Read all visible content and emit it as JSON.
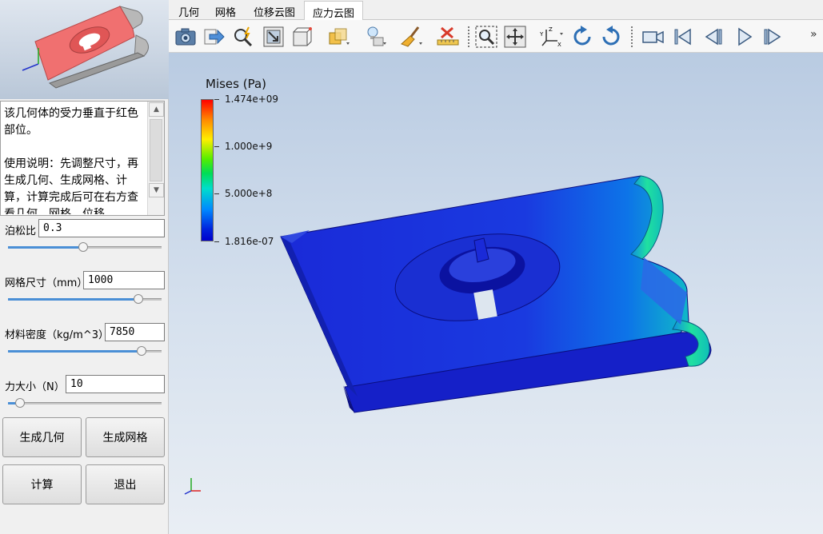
{
  "tabs": [
    "几何",
    "网格",
    "位移云图",
    "应力云图"
  ],
  "active_tab_index": 3,
  "description": "该几何体的受力垂直于红色部位。\n\n使用说明：先调整尺寸，再生成几何、生成网格、计算，计算完成后可在右方查看几何、网格、位移",
  "params": {
    "poisson": {
      "label": "泊松比",
      "value": "0.3",
      "slider": 0.49
    },
    "mesh": {
      "label": "网格尺寸（mm）",
      "value": "1000",
      "slider": 0.85
    },
    "density": {
      "label": "材料密度（kg/m^3）",
      "value": "7850",
      "slider": 0.87
    },
    "force": {
      "label": "力大小（N）",
      "value": "10",
      "slider": 0.08
    }
  },
  "buttons": {
    "gen_geometry": "生成几何",
    "gen_mesh": "生成网格",
    "compute": "计算",
    "exit": "退出"
  },
  "toolbar_icons": [
    "camera-icon",
    "export-icon",
    "zoom-pick-icon",
    "reset-camera-icon",
    "box-select-icon",
    "surface-render-icon",
    "lighting-icon",
    "clear-brush-icon",
    "ruler-delete-icon",
    "zoom-box-icon",
    "fit-view-icon",
    "axes-orient-icon",
    "rotate-cw-icon",
    "rotate-ccw-icon",
    "record-icon",
    "first-frame-icon",
    "prev-frame-icon",
    "play-icon",
    "last-frame-icon"
  ],
  "legend": {
    "title": "Mises (Pa)",
    "labels": [
      "1.474e+09",
      "1.000e+9",
      "5.000e+8",
      "1.816e-07"
    ],
    "colors": [
      "#ff0000",
      "#ffee00",
      "#00dd55",
      "#0000cc"
    ]
  },
  "more_label": "»"
}
